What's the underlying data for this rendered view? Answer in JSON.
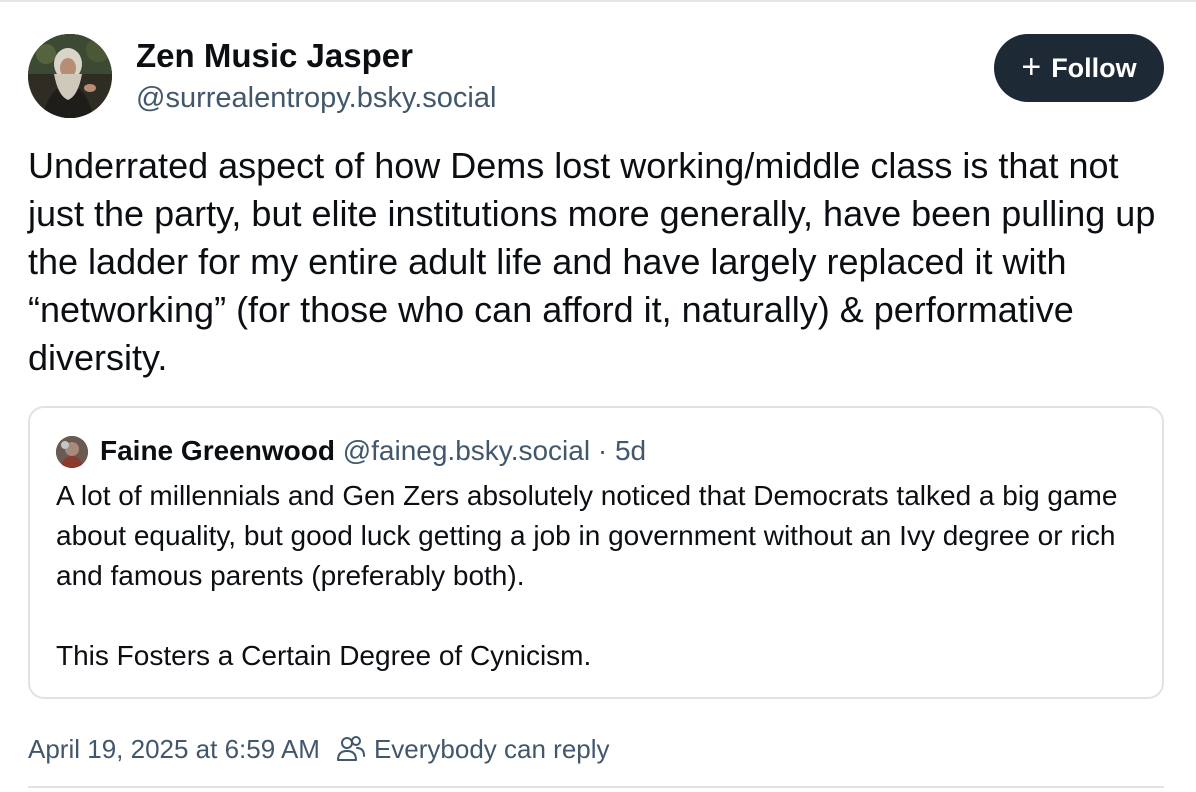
{
  "post": {
    "author": {
      "display_name": "Zen Music Jasper",
      "handle": "@surrealentropy.bsky.social"
    },
    "follow_button": {
      "icon": "plus-icon",
      "label": "Follow"
    },
    "text": "Underrated aspect of how Dems lost working/middle class is that not just the party, but elite institutions more generally, have been pulling up the ladder for my entire adult life and have largely replaced it with “networking” (for those who can afford it, naturally) & performative diversity.",
    "quoted_post": {
      "author_name": "Faine Greenwood",
      "handle": "@faineg.bsky.social",
      "separator": "·",
      "time_ago": "5d",
      "paragraphs": [
        "A lot of millennials and Gen Zers absolutely noticed that Democrats talked a big game about equality, but good luck getting a job in government without an Ivy degree or rich and famous parents (preferably both).",
        "This Fosters a Certain Degree of Cynicism."
      ]
    },
    "timestamp": "April 19, 2025 at 6:59 AM",
    "reply_setting": {
      "icon": "people-icon",
      "label": "Everybody can reply"
    }
  },
  "colors": {
    "text_primary": "#0b0f14",
    "text_secondary": "#42576c",
    "follow_button_bg": "#1e2936",
    "border": "#dfe3e8"
  }
}
